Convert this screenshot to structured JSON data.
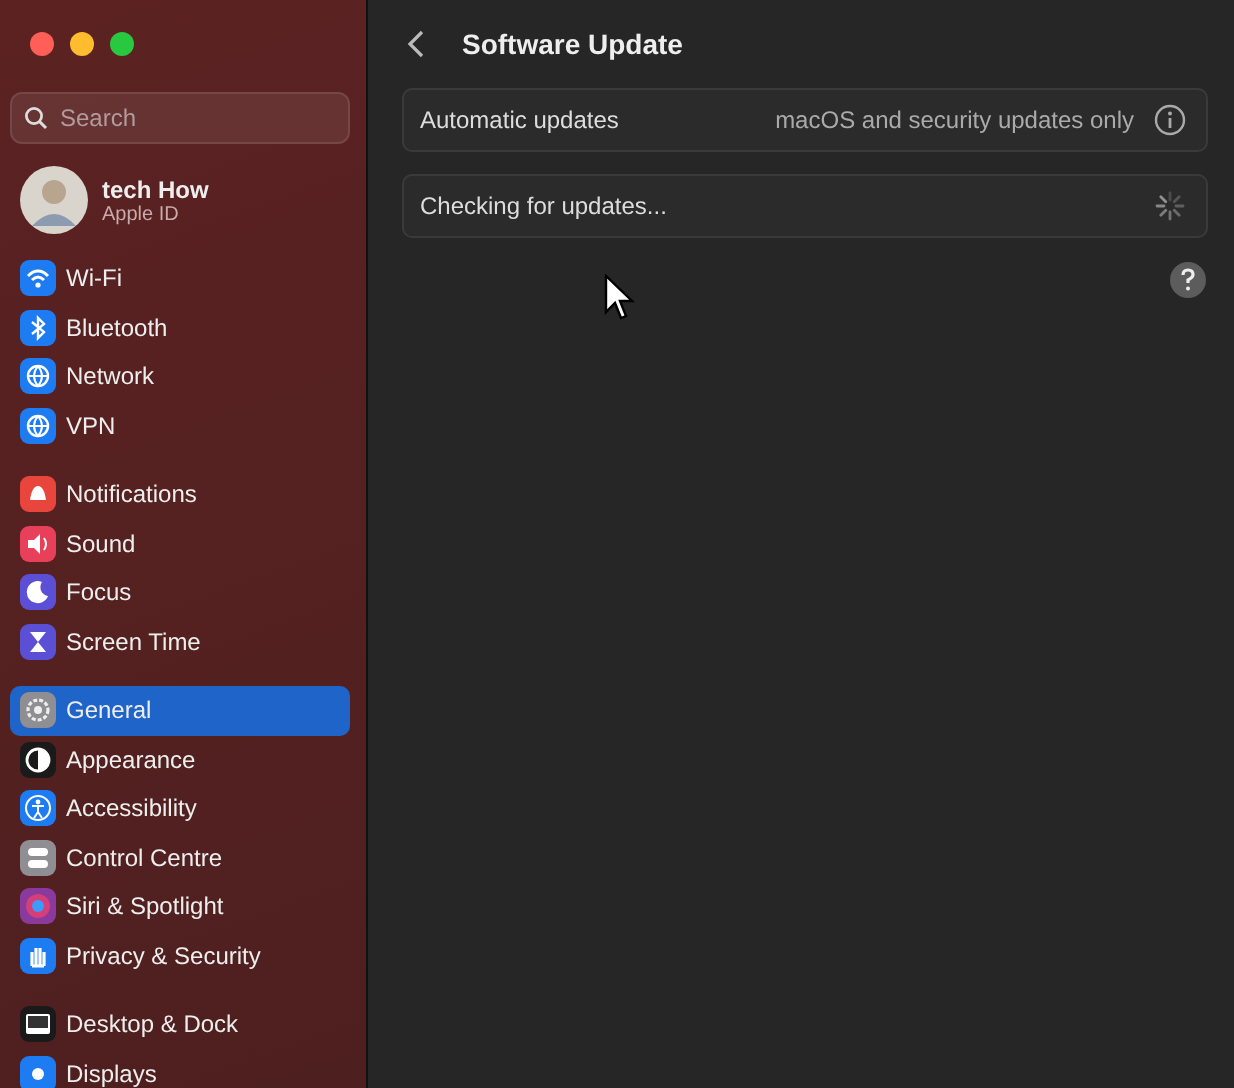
{
  "sidebar": {
    "search": {
      "placeholder": "Search"
    },
    "account": {
      "name": "tech How",
      "subtitle": "Apple ID"
    },
    "groups": [
      [
        {
          "label": "Wi-Fi",
          "color": "#1e7cf2",
          "selected": false
        },
        {
          "label": "Bluetooth",
          "color": "#1e7cf2",
          "selected": false
        },
        {
          "label": "Network",
          "color": "#1e7cf2",
          "selected": false
        },
        {
          "label": "VPN",
          "color": "#1e7cf2",
          "selected": false
        }
      ],
      [
        {
          "label": "Notifications",
          "color": "#e8453c",
          "selected": false
        },
        {
          "label": "Sound",
          "color": "#e8405a",
          "selected": false
        },
        {
          "label": "Focus",
          "color": "#5b4fd6",
          "selected": false
        },
        {
          "label": "Screen Time",
          "color": "#5b4fd6",
          "selected": false
        }
      ],
      [
        {
          "label": "General",
          "color": "#8e8e93",
          "selected": true
        },
        {
          "label": "Appearance",
          "color": "#1a1a1a",
          "selected": false
        },
        {
          "label": "Accessibility",
          "color": "#1e7cf2",
          "selected": false
        },
        {
          "label": "Control Centre",
          "color": "#8e8e93",
          "selected": false
        },
        {
          "label": "Siri & Spotlight",
          "color": "#8a3a9c",
          "selected": false
        },
        {
          "label": "Privacy & Security",
          "color": "#1e7cf2",
          "selected": false
        }
      ],
      [
        {
          "label": "Desktop & Dock",
          "color": "#1a1a1a",
          "selected": false
        },
        {
          "label": "Displays",
          "color": "#1e7cf2",
          "selected": false
        }
      ]
    ]
  },
  "main": {
    "title": "Software Update",
    "rows": [
      {
        "label": "Automatic updates",
        "value": "macOS and security updates only",
        "kind": "info"
      },
      {
        "label": "Checking for updates...",
        "kind": "spinner"
      }
    ]
  }
}
